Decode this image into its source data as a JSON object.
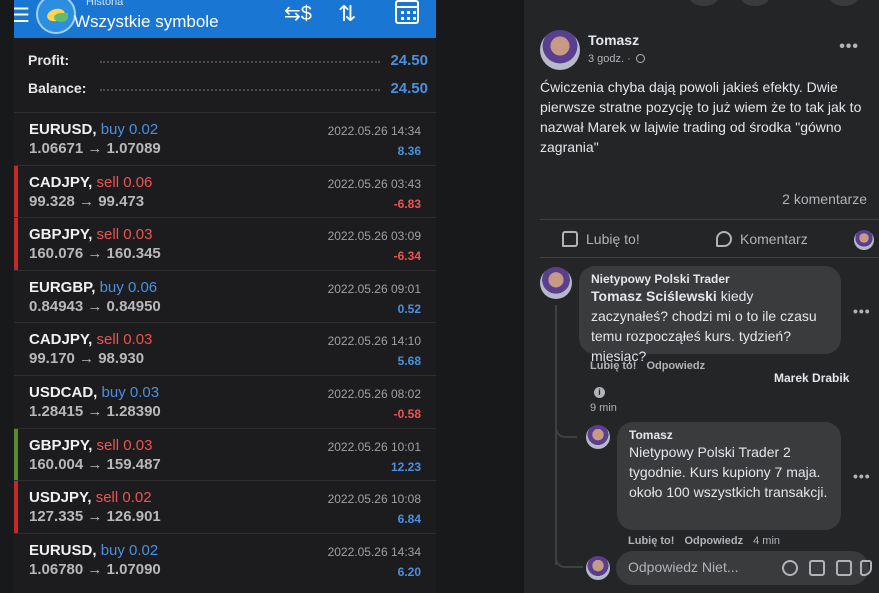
{
  "mt": {
    "header": {
      "subtitle": "Historia",
      "title": "Wszystkie symbole",
      "menu_icon": "menu-icon",
      "currency_icon": "currency-icon",
      "sort_icon": "sort-icon",
      "calendar_icon": "calendar-icon"
    },
    "summary": [
      {
        "label": "Profit:",
        "value": "24.50"
      },
      {
        "label": "Balance:",
        "value": "24.50"
      }
    ],
    "deals": [
      {
        "symbol": "EURUSD,",
        "side": "buy 0.02",
        "prices": "1.06671 → 1.07089",
        "time": "2022.05.26 14:34",
        "profit": "8.36"
      },
      {
        "symbol": "CADJPY,",
        "side": "sell 0.06",
        "prices": "99.328 → 99.473",
        "time": "2022.05.26 03:43",
        "profit": "-6.83"
      },
      {
        "symbol": "GBPJPY,",
        "side": "sell 0.03",
        "prices": "160.076 → 160.345",
        "time": "2022.05.26 03:09",
        "profit": "-6.34"
      },
      {
        "symbol": "EURGBP,",
        "side": "buy 0.06",
        "prices": "0.84943 → 0.84950",
        "time": "2022.05.26 09:01",
        "profit": "0.52"
      },
      {
        "symbol": "CADJPY,",
        "side": "sell 0.03",
        "prices": "99.170 → 98.930",
        "time": "2022.05.26 14:10",
        "profit": "5.68"
      },
      {
        "symbol": "USDCAD,",
        "side": "buy 0.03",
        "prices": "1.28415 → 1.28390",
        "time": "2022.05.26 08:02",
        "profit": "-0.58"
      },
      {
        "symbol": "GBPJPY,",
        "side": "sell 0.03",
        "prices": "160.004 → 159.487",
        "time": "2022.05.26 10:01",
        "profit": "12.23"
      },
      {
        "symbol": "USDJPY,",
        "side": "sell 0.02",
        "prices": "127.335 → 126.901",
        "time": "2022.05.26 10:08",
        "profit": "6.84"
      },
      {
        "symbol": "EURUSD,",
        "side": "buy 0.02",
        "prices": "1.06780 → 1.07090",
        "time": "2022.05.26 14:34",
        "profit": "6.20"
      }
    ],
    "colors": {
      "header": "#1976d2",
      "buy": "#4a90e2",
      "sell": "#ef5350",
      "positive": "#4a90e2",
      "negative": "#ef5350",
      "bar_sell": "#c62828",
      "bar_green": "#558b2f"
    }
  },
  "fb": {
    "post": {
      "author": "Tomasz",
      "time": "3 godz. ·",
      "text": "Ćwiczenia chyba dają powoli jakieś efekty. Dwie pierwsze stratne pozycję to już wiem że to tak jak to nazwał Marek w lajwie trading od środka \"gówno zagrania\"",
      "comments_count": "2 komentarze",
      "like_label": "Lubię to!",
      "comment_label": "Komentarz"
    },
    "comments": [
      {
        "author": "Nietypowy Polski Trader",
        "mention": "Tomasz Sciślewski",
        "text": " kiedy zaczynałeś? chodzi mi o to ile czasu temu rozpocząłeś kurs. tydzień? miesiąc?",
        "like": "Lubię to!",
        "reply": "Odpowiedz",
        "replier": "Marek Drabik",
        "time": "9 min"
      },
      {
        "author": "Tomasz",
        "mention": "Nietypowy Polski Trader",
        "text": " 2 tygodnie. Kurs kupiony 7 maja. około 100 wszystkich transakcji.",
        "like": "Lubię to!",
        "reply": "Odpowiedz",
        "time": "4 min"
      }
    ],
    "reply_box": {
      "placeholder": "Odpowiedz Niet..."
    }
  }
}
